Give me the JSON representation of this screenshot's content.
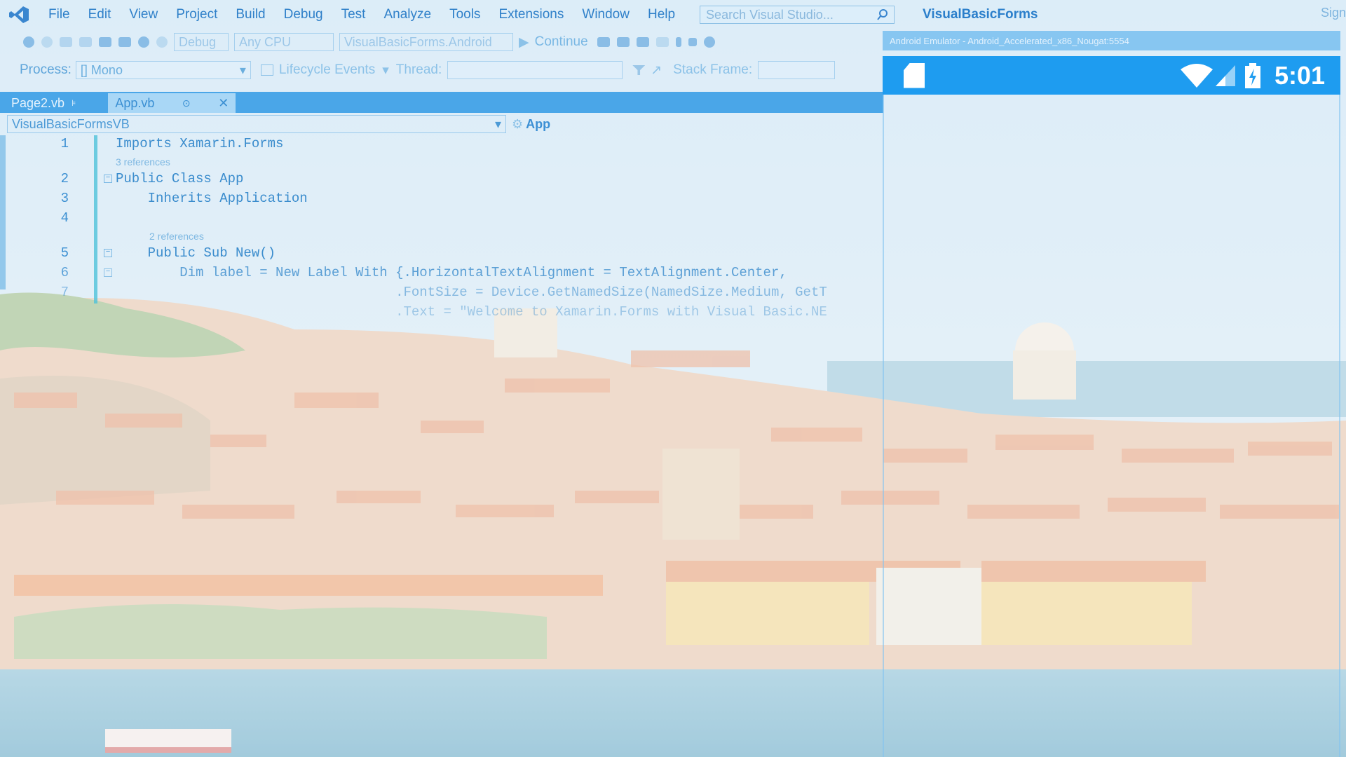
{
  "menubar": {
    "items": [
      "File",
      "Edit",
      "View",
      "Project",
      "Build",
      "Debug",
      "Test",
      "Analyze",
      "Tools",
      "Extensions",
      "Window",
      "Help"
    ],
    "search_placeholder": "Search Visual Studio...",
    "solution_title": "VisualBasicForms",
    "sign_in": "Sign"
  },
  "toolbar": {
    "config": "Debug",
    "platform": "Any CPU",
    "startup_project": "VisualBasicForms.Android",
    "continue_label": "Continue"
  },
  "toolbar2": {
    "process_label": "Process:",
    "process_value": "[] Mono",
    "lifecycle_label": "Lifecycle Events",
    "thread_label": "Thread:",
    "stack_frame_label": "Stack Frame:"
  },
  "tabs": [
    {
      "label": "Page2.vb"
    },
    {
      "label": "App.vb"
    }
  ],
  "navbar": {
    "left": "VisualBasicFormsVB",
    "right": "App"
  },
  "code": {
    "lines": [
      {
        "num": "1",
        "text": "Imports Xamarin.Forms"
      },
      {
        "num": "",
        "lens": "3 references"
      },
      {
        "num": "2",
        "text": "Public Class App"
      },
      {
        "num": "3",
        "text": "    Inherits Application"
      },
      {
        "num": "4",
        "text": ""
      },
      {
        "num": "",
        "lens": "2 references"
      },
      {
        "num": "5",
        "text": "    Public Sub New()"
      },
      {
        "num": "6",
        "text": "        Dim label = New Label With {.HorizontalTextAlignment = TextAlignment.Center,"
      },
      {
        "num": "7",
        "text": "                                   .FontSize = Device.GetNamedSize(NamedSize.Medium, GetT"
      },
      {
        "num": "",
        "text": "                                   .Text = \"Welcome to Xamarin.Forms with Visual Basic.NE"
      }
    ]
  },
  "emulator": {
    "title": "Android Emulator - Android_Accelerated_x86_Nougat:5554",
    "time": "5:01"
  },
  "colors": {
    "accent": "#1e9cf0",
    "vs_blue": "#2f80c9"
  }
}
